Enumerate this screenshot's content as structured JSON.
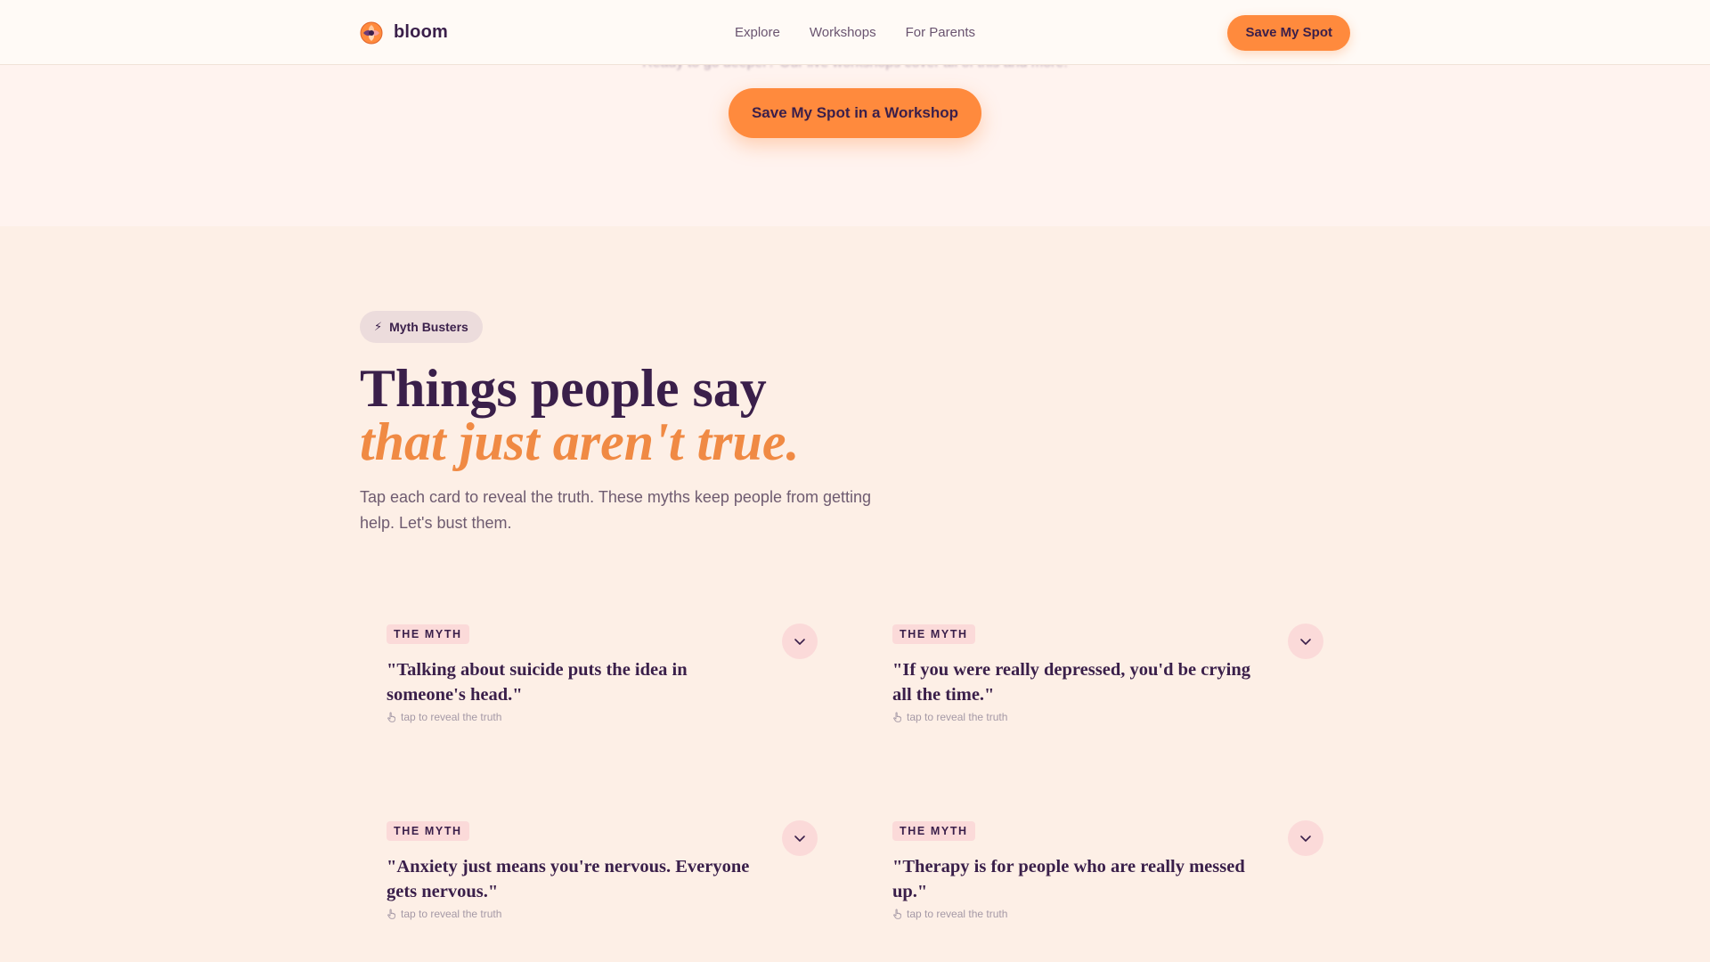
{
  "nav": {
    "brand": "bloom",
    "links": [
      "Explore",
      "Workshops",
      "For Parents"
    ],
    "cta": "Save My Spot"
  },
  "hero": {
    "faded_text": "Ready to go deeper? Our live workshops cover all of this and more.",
    "cta": "Save My Spot in a Workshop"
  },
  "section": {
    "badge": "Myth Busters",
    "badge_icon": "lightning-icon",
    "title_line1": "Things people say",
    "title_line2": "that just aren't true.",
    "lede": "Tap each card to reveal the truth. These myths keep people from getting help. Let's bust them."
  },
  "cards": [
    {
      "tag": "THE MYTH",
      "quote": "\"Talking about suicide puts the idea in someone's head.\"",
      "hint": "tap to reveal the truth"
    },
    {
      "tag": "THE MYTH",
      "quote": "\"If you were really depressed, you'd be crying all the time.\"",
      "hint": "tap to reveal the truth"
    },
    {
      "tag": "THE MYTH",
      "quote": "\"Anxiety just means you're nervous. Everyone gets nervous.\"",
      "hint": "tap to reveal the truth"
    },
    {
      "tag": "THE MYTH",
      "quote": "\"Therapy is for people who are really messed up.\"",
      "hint": "tap to reveal the truth"
    }
  ],
  "colors": {
    "accent": "#ff8a3d",
    "heading": "#3a1f4a",
    "tag_bg": "#fbdad9",
    "section_bg": "#fdefe6"
  }
}
